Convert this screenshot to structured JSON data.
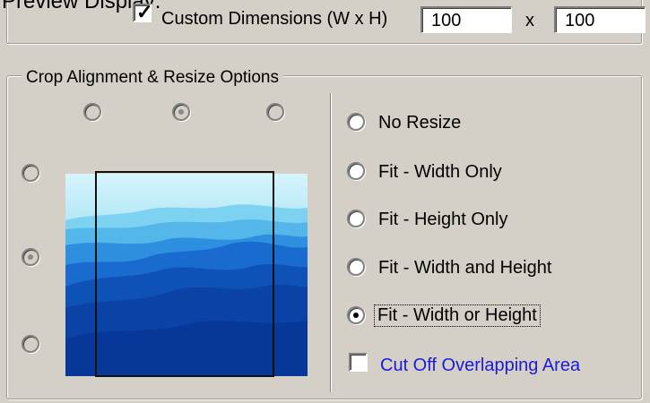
{
  "header": {
    "section_title": "Preview Display:",
    "custom_dimensions_label": "Custom Dimensions (W x H)",
    "custom_dimensions_checked": true,
    "width_value": "100",
    "height_value": "100",
    "times_label": "x"
  },
  "crop_group": {
    "legend": "Crop Alignment & Resize Options",
    "alignment": {
      "top_row": [
        "top-left",
        "top-center",
        "top-right"
      ],
      "left_column": [
        "middle-left",
        "bottom-left-extra",
        "bottom-left"
      ],
      "selected": [
        "top-center",
        "middle-left"
      ]
    },
    "resize_options": [
      {
        "label": "No Resize",
        "selected": false
      },
      {
        "label": "Fit - Width Only",
        "selected": false
      },
      {
        "label": "Fit - Height Only",
        "selected": false
      },
      {
        "label": "Fit - Width and Height",
        "selected": false
      },
      {
        "label": "Fit - Width or Height",
        "selected": true
      }
    ],
    "cut_off": {
      "label": "Cut Off Overlapping Area",
      "checked": false,
      "color": "#1b1bd9"
    }
  },
  "colors": {
    "window_bg": "#d4d0c8",
    "sky_top": "#d6f4fb",
    "sky_mid": "#7fd6f2",
    "mountain_dark": "#0a3a9a"
  }
}
